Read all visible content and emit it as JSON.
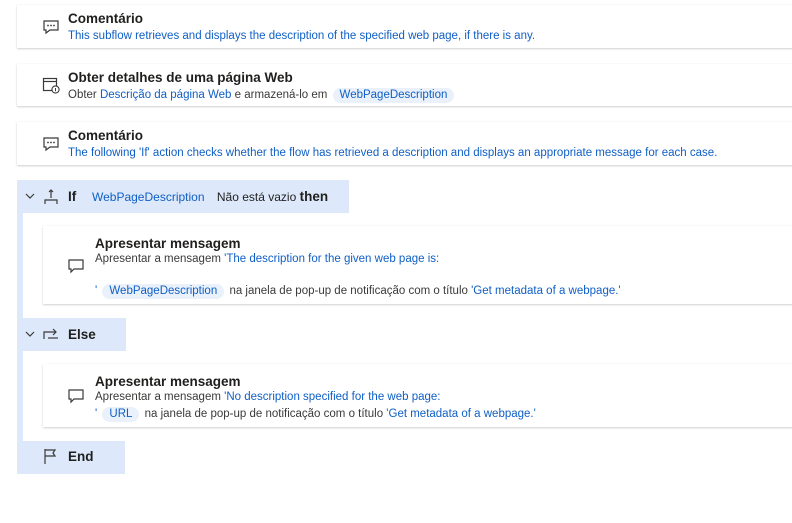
{
  "step1": {
    "title": "Comentário",
    "text": "This subflow retrieves and displays the description of the specified web page, if there is any."
  },
  "step2": {
    "title": "Obter detalhes de uma página Web",
    "prefix": "Obter",
    "link": "Descrição da página Web",
    "middle": "e armazená-lo em",
    "variable": "WebPageDescription"
  },
  "step3": {
    "title": "Comentário",
    "text": "The following 'If' action checks whether the flow has retrieved a description and displays an appropriate message for each case."
  },
  "if_block": {
    "keyword": "If",
    "variable": "WebPageDescription",
    "condition": "Não está vazio",
    "then": "then"
  },
  "step4": {
    "title": "Apresentar mensagem",
    "prefix": "Apresentar a mensagem",
    "message_line1": "'The description for the given web page is:",
    "quote": "'",
    "variable": "WebPageDescription",
    "middle": "na janela de pop-up de notificação com o título",
    "popup_title": "'Get metadata of a webpage.'"
  },
  "else_block": {
    "keyword": "Else"
  },
  "step5": {
    "title": "Apresentar mensagem",
    "prefix": "Apresentar a mensagem",
    "message_line1": "'No description specified for the web page:",
    "quote": "'",
    "variable": "URL",
    "middle": "na janela de pop-up de notificação com o título",
    "popup_title": "'Get metadata of a webpage.'"
  },
  "end_block": {
    "keyword": "End"
  }
}
